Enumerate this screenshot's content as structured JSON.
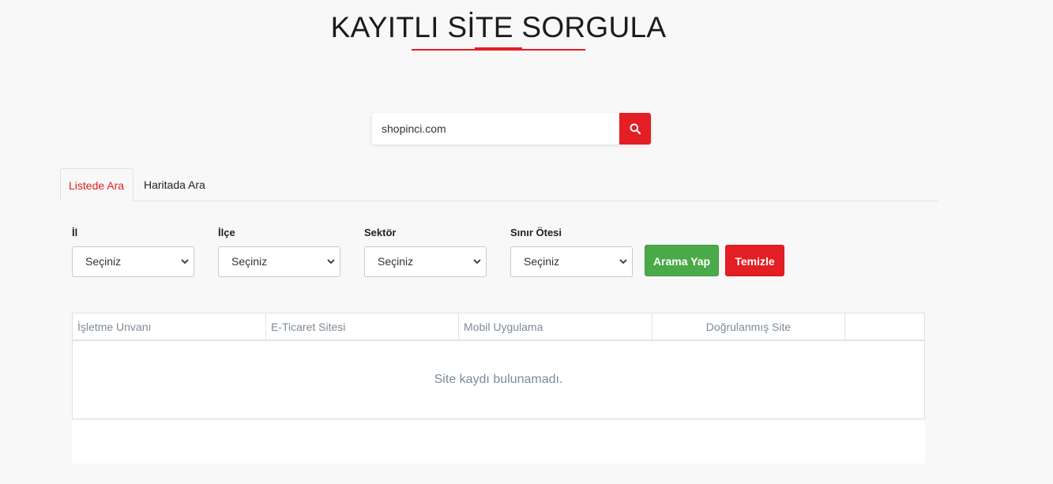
{
  "page": {
    "title": "KAYITLI SİTE SORGULA",
    "accent_color": "#e31e24",
    "success_color": "#4aaa49"
  },
  "search": {
    "value": "shopinci.com",
    "button_icon": "search-icon"
  },
  "tabs": [
    {
      "label": "Listede Ara",
      "active": true
    },
    {
      "label": "Haritada Ara",
      "active": false
    }
  ],
  "filters": [
    {
      "label": "İl",
      "selected": "Seçiniz"
    },
    {
      "label": "İlçe",
      "selected": "Seçiniz"
    },
    {
      "label": "Sektör",
      "selected": "Seçiniz"
    },
    {
      "label": "Sınır Ötesi",
      "selected": "Seçiniz"
    }
  ],
  "actions": {
    "search_label": "Arama Yap",
    "clear_label": "Temizle"
  },
  "table": {
    "columns": [
      "İşletme Unvanı",
      "E-Ticaret Sitesi",
      "Mobil Uygulama",
      "Doğrulanmış Site",
      ""
    ],
    "empty_message": "Site kaydı bulunamadı."
  }
}
